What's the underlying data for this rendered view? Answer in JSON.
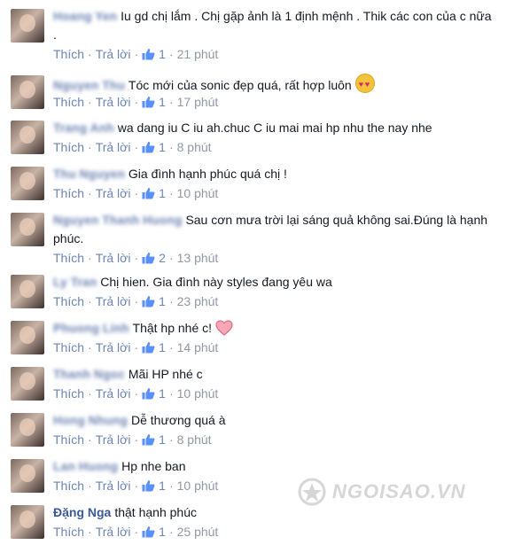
{
  "actions": {
    "like_label": "Thích",
    "reply_label": "Trả lời",
    "separator": "·"
  },
  "comments": [
    {
      "name": "Hoang Yen",
      "text": "Iu gd chị lắm . Chị gặp ảnh là 1 định mệnh . Thik các con của c nữa .",
      "likes": "1",
      "time": "21 phút",
      "emoji": ""
    },
    {
      "name": "Nguyen Thu",
      "text": "Tóc mới của sonic đẹp quá, rất hợp luôn",
      "likes": "1",
      "time": "17 phút",
      "emoji": "heart-eyes"
    },
    {
      "name": "Trang Anh",
      "text": "wa dang iu C iu ah.chuc C iu mai mai hp nhu the nay nhe",
      "likes": "1",
      "time": "8 phút",
      "emoji": ""
    },
    {
      "name": "Thu Nguyen",
      "text": "Gia đình hạnh phúc quá chị !",
      "likes": "1",
      "time": "10 phút",
      "emoji": ""
    },
    {
      "name": "Nguyen Thanh Huong",
      "text": "Sau cơn mưa trời lại sáng quả không sai.Đúng là hạnh phúc.",
      "likes": "2",
      "time": "13 phút",
      "emoji": ""
    },
    {
      "name": "Ly Tran",
      "text": "Chị hien. Gia đình này styles đang yêu wa",
      "likes": "1",
      "time": "23 phút",
      "emoji": ""
    },
    {
      "name": "Phuong Linh",
      "text": "Thật hp nhé c!",
      "likes": "1",
      "time": "14 phút",
      "emoji": "heart"
    },
    {
      "name": "Thanh Ngoc",
      "text": "Mãi HP nhé c",
      "likes": "1",
      "time": "10 phút",
      "emoji": ""
    },
    {
      "name": "Hong Nhung",
      "text": "Dễ thương quá à",
      "likes": "1",
      "time": "8 phút",
      "emoji": ""
    },
    {
      "name": "Lan Huong",
      "text": "Hp nhe ban",
      "likes": "1",
      "time": "10 phút",
      "emoji": ""
    },
    {
      "name": "Đặng Nga",
      "text": "thật hạnh phúc",
      "likes": "1",
      "time": "25 phút",
      "emoji": ""
    }
  ],
  "watermark": {
    "text": "NGOISAO.VN"
  },
  "colors": {
    "link": "#3b5998",
    "action": "#6d84b4",
    "meta": "#9197a3",
    "text": "#141823"
  }
}
